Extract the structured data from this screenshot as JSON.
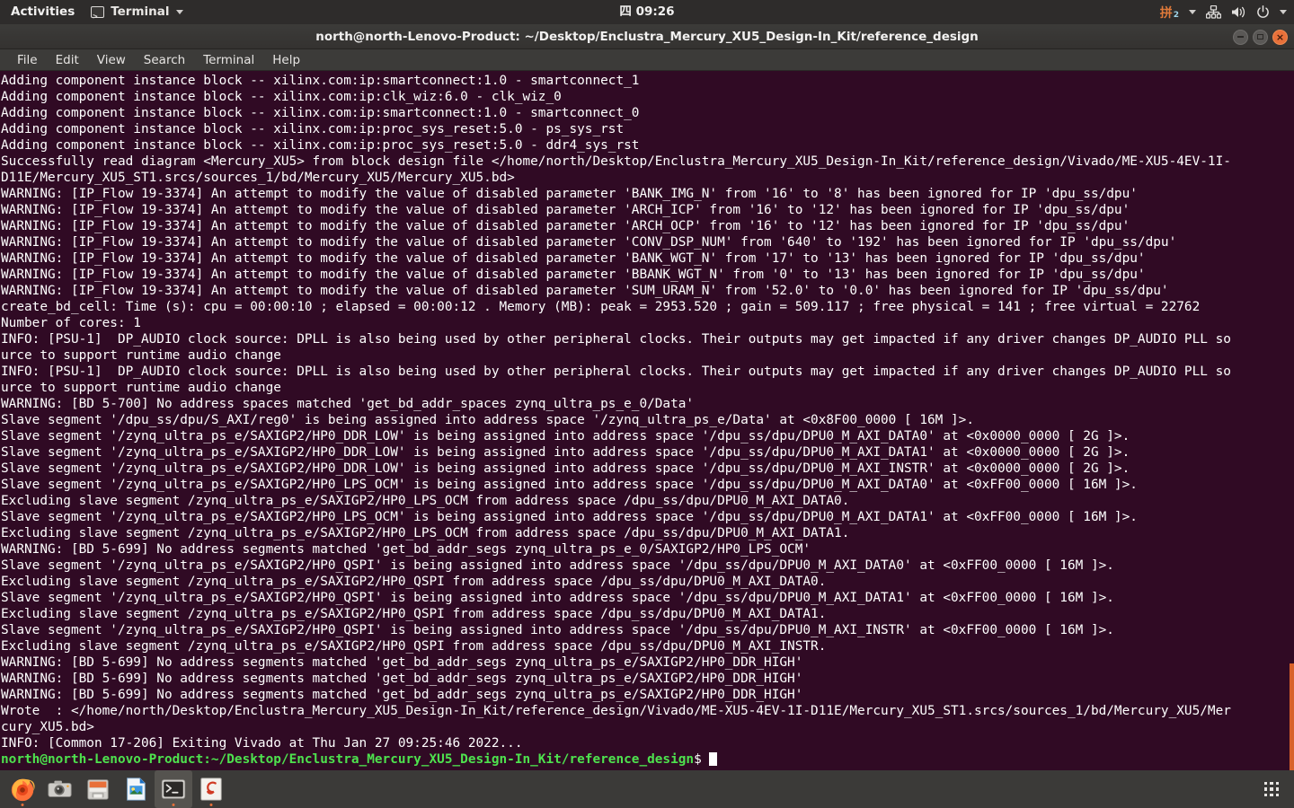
{
  "topbar": {
    "activities": "Activities",
    "app_name": "Terminal",
    "app_icon": "terminal-icon",
    "clock": "四 09:26",
    "ibus_glyph": "拼",
    "ibus_sub": "2",
    "icons": [
      "network-icon",
      "volume-icon",
      "power-icon",
      "chevron-down-icon"
    ]
  },
  "window": {
    "title": "north@north-Lenovo-Product: ~/Desktop/Enclustra_Mercury_XU5_Design-In_Kit/reference_design",
    "buttons": {
      "minimize": "minimize-button",
      "maximize": "maximize-button",
      "close": "×"
    }
  },
  "menubar": {
    "items": [
      "File",
      "Edit",
      "View",
      "Search",
      "Terminal",
      "Help"
    ]
  },
  "terminal": {
    "colors": {
      "background": "#300a24",
      "foreground": "#ffffff",
      "prompt": "#4ee24e",
      "scrollbar": "#d8622a"
    },
    "lines": [
      "Adding component instance block -- xilinx.com:ip:smartconnect:1.0 - smartconnect_1",
      "Adding component instance block -- xilinx.com:ip:clk_wiz:6.0 - clk_wiz_0",
      "Adding component instance block -- xilinx.com:ip:smartconnect:1.0 - smartconnect_0",
      "Adding component instance block -- xilinx.com:ip:proc_sys_reset:5.0 - ps_sys_rst",
      "Adding component instance block -- xilinx.com:ip:proc_sys_reset:5.0 - ddr4_sys_rst",
      "Successfully read diagram <Mercury_XU5> from block design file </home/north/Desktop/Enclustra_Mercury_XU5_Design-In_Kit/reference_design/Vivado/ME-XU5-4EV-1I-",
      "D11E/Mercury_XU5_ST1.srcs/sources_1/bd/Mercury_XU5/Mercury_XU5.bd>",
      "WARNING: [IP_Flow 19-3374] An attempt to modify the value of disabled parameter 'BANK_IMG_N' from '16' to '8' has been ignored for IP 'dpu_ss/dpu'",
      "WARNING: [IP_Flow 19-3374] An attempt to modify the value of disabled parameter 'ARCH_ICP' from '16' to '12' has been ignored for IP 'dpu_ss/dpu'",
      "WARNING: [IP_Flow 19-3374] An attempt to modify the value of disabled parameter 'ARCH_OCP' from '16' to '12' has been ignored for IP 'dpu_ss/dpu'",
      "WARNING: [IP_Flow 19-3374] An attempt to modify the value of disabled parameter 'CONV_DSP_NUM' from '640' to '192' has been ignored for IP 'dpu_ss/dpu'",
      "WARNING: [IP_Flow 19-3374] An attempt to modify the value of disabled parameter 'BANK_WGT_N' from '17' to '13' has been ignored for IP 'dpu_ss/dpu'",
      "WARNING: [IP_Flow 19-3374] An attempt to modify the value of disabled parameter 'BBANK_WGT_N' from '0' to '13' has been ignored for IP 'dpu_ss/dpu'",
      "WARNING: [IP_Flow 19-3374] An attempt to modify the value of disabled parameter 'SUM_URAM_N' from '52.0' to '0.0' has been ignored for IP 'dpu_ss/dpu'",
      "create_bd_cell: Time (s): cpu = 00:00:10 ; elapsed = 00:00:12 . Memory (MB): peak = 2953.520 ; gain = 509.117 ; free physical = 141 ; free virtual = 22762",
      "Number of cores: 1",
      "INFO: [PSU-1]  DP_AUDIO clock source: DPLL is also being used by other peripheral clocks. Their outputs may get impacted if any driver changes DP_AUDIO PLL so",
      "urce to support runtime audio change",
      "INFO: [PSU-1]  DP_AUDIO clock source: DPLL is also being used by other peripheral clocks. Their outputs may get impacted if any driver changes DP_AUDIO PLL so",
      "urce to support runtime audio change",
      "WARNING: [BD 5-700] No address spaces matched 'get_bd_addr_spaces zynq_ultra_ps_e_0/Data'",
      "Slave segment '/dpu_ss/dpu/S_AXI/reg0' is being assigned into address space '/zynq_ultra_ps_e/Data' at <0x8F00_0000 [ 16M ]>.",
      "Slave segment '/zynq_ultra_ps_e/SAXIGP2/HP0_DDR_LOW' is being assigned into address space '/dpu_ss/dpu/DPU0_M_AXI_DATA0' at <0x0000_0000 [ 2G ]>.",
      "Slave segment '/zynq_ultra_ps_e/SAXIGP2/HP0_DDR_LOW' is being assigned into address space '/dpu_ss/dpu/DPU0_M_AXI_DATA1' at <0x0000_0000 [ 2G ]>.",
      "Slave segment '/zynq_ultra_ps_e/SAXIGP2/HP0_DDR_LOW' is being assigned into address space '/dpu_ss/dpu/DPU0_M_AXI_INSTR' at <0x0000_0000 [ 2G ]>.",
      "Slave segment '/zynq_ultra_ps_e/SAXIGP2/HP0_LPS_OCM' is being assigned into address space '/dpu_ss/dpu/DPU0_M_AXI_DATA0' at <0xFF00_0000 [ 16M ]>.",
      "Excluding slave segment /zynq_ultra_ps_e/SAXIGP2/HP0_LPS_OCM from address space /dpu_ss/dpu/DPU0_M_AXI_DATA0.",
      "Slave segment '/zynq_ultra_ps_e/SAXIGP2/HP0_LPS_OCM' is being assigned into address space '/dpu_ss/dpu/DPU0_M_AXI_DATA1' at <0xFF00_0000 [ 16M ]>.",
      "Excluding slave segment /zynq_ultra_ps_e/SAXIGP2/HP0_LPS_OCM from address space /dpu_ss/dpu/DPU0_M_AXI_DATA1.",
      "WARNING: [BD 5-699] No address segments matched 'get_bd_addr_segs zynq_ultra_ps_e_0/SAXIGP2/HP0_LPS_OCM'",
      "Slave segment '/zynq_ultra_ps_e/SAXIGP2/HP0_QSPI' is being assigned into address space '/dpu_ss/dpu/DPU0_M_AXI_DATA0' at <0xFF00_0000 [ 16M ]>.",
      "Excluding slave segment /zynq_ultra_ps_e/SAXIGP2/HP0_QSPI from address space /dpu_ss/dpu/DPU0_M_AXI_DATA0.",
      "Slave segment '/zynq_ultra_ps_e/SAXIGP2/HP0_QSPI' is being assigned into address space '/dpu_ss/dpu/DPU0_M_AXI_DATA1' at <0xFF00_0000 [ 16M ]>.",
      "Excluding slave segment /zynq_ultra_ps_e/SAXIGP2/HP0_QSPI from address space /dpu_ss/dpu/DPU0_M_AXI_DATA1.",
      "Slave segment '/zynq_ultra_ps_e/SAXIGP2/HP0_QSPI' is being assigned into address space '/dpu_ss/dpu/DPU0_M_AXI_INSTR' at <0xFF00_0000 [ 16M ]>.",
      "Excluding slave segment /zynq_ultra_ps_e/SAXIGP2/HP0_QSPI from address space /dpu_ss/dpu/DPU0_M_AXI_INSTR.",
      "WARNING: [BD 5-699] No address segments matched 'get_bd_addr_segs zynq_ultra_ps_e/SAXIGP2/HP0_DDR_HIGH'",
      "WARNING: [BD 5-699] No address segments matched 'get_bd_addr_segs zynq_ultra_ps_e/SAXIGP2/HP0_DDR_HIGH'",
      "WARNING: [BD 5-699] No address segments matched 'get_bd_addr_segs zynq_ultra_ps_e/SAXIGP2/HP0_DDR_HIGH'",
      "Wrote  : </home/north/Desktop/Enclustra_Mercury_XU5_Design-In_Kit/reference_design/Vivado/ME-XU5-4EV-1I-D11E/Mercury_XU5_ST1.srcs/sources_1/bd/Mercury_XU5/Mer",
      "cury_XU5.bd>",
      "INFO: [Common 17-206] Exiting Vivado at Thu Jan 27 09:25:46 2022..."
    ],
    "prompt": {
      "user_host_path": "north@north-Lenovo-Product:~/Desktop/Enclustra_Mercury_XU5_Design-In_Kit/reference_design",
      "symbol": "$"
    }
  },
  "dock": {
    "items": [
      {
        "name": "firefox",
        "running": true
      },
      {
        "name": "screenshot-camera",
        "running": false
      },
      {
        "name": "file-manager",
        "running": false
      },
      {
        "name": "document-viewer",
        "running": false
      },
      {
        "name": "terminal",
        "running": true,
        "active": true
      },
      {
        "name": "text-editor",
        "running": true
      }
    ],
    "show_apps": "show-applications"
  }
}
